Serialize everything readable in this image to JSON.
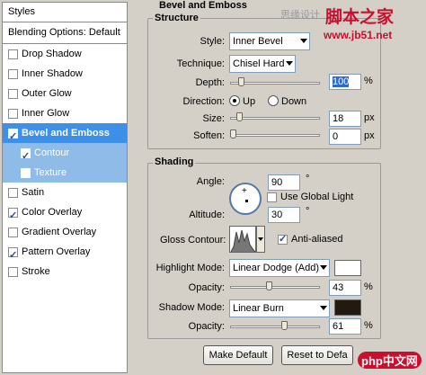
{
  "styles_panel": {
    "title": "Styles",
    "blending_options": "Blending Options: Default",
    "items": [
      {
        "label": "Drop Shadow",
        "checked": false
      },
      {
        "label": "Inner Shadow",
        "checked": false
      },
      {
        "label": "Outer Glow",
        "checked": false
      },
      {
        "label": "Inner Glow",
        "checked": false
      },
      {
        "label": "Bevel and Emboss",
        "checked": true
      },
      {
        "label": "Contour",
        "checked": true
      },
      {
        "label": "Texture",
        "checked": false
      },
      {
        "label": "Satin",
        "checked": false
      },
      {
        "label": "Color Overlay",
        "checked": true
      },
      {
        "label": "Gradient Overlay",
        "checked": false
      },
      {
        "label": "Pattern Overlay",
        "checked": true
      },
      {
        "label": "Stroke",
        "checked": false
      }
    ]
  },
  "bevel": {
    "title": "Bevel and Emboss",
    "structure": {
      "title": "Structure",
      "style_label": "Style:",
      "style_value": "Inner Bevel",
      "technique_label": "Technique:",
      "technique_value": "Chisel Hard",
      "depth_label": "Depth:",
      "depth_value": "100",
      "depth_unit": "%",
      "depth_level": 0.1,
      "direction_label": "Direction:",
      "up_label": "Up",
      "down_label": "Down",
      "size_label": "Size:",
      "size_value": "18",
      "size_unit": "px",
      "size_level": 0.07,
      "soften_label": "Soften:",
      "soften_value": "0",
      "soften_unit": "px",
      "soften_level": 0.0
    },
    "shading": {
      "title": "Shading",
      "angle_label": "Angle:",
      "angle_value": "90",
      "angle_unit": "°",
      "global_light_label": "Use Global Light",
      "altitude_label": "Altitude:",
      "altitude_value": "30",
      "altitude_unit": "°",
      "gloss_label": "Gloss Contour:",
      "anti_aliased_label": "Anti-aliased",
      "highlight_mode_label": "Highlight Mode:",
      "highlight_mode_value": "Linear Dodge (Add)",
      "highlight_color": "#ffffff",
      "highlight_opacity_label": "Opacity:",
      "highlight_opacity_value": "43",
      "highlight_opacity_unit": "%",
      "highlight_opacity_level": 0.43,
      "shadow_mode_label": "Shadow Mode:",
      "shadow_mode_value": "Linear Burn",
      "shadow_color": "#221a10",
      "shadow_opacity_label": "Opacity:",
      "shadow_opacity_value": "61",
      "shadow_opacity_unit": "%",
      "shadow_opacity_level": 0.61
    },
    "make_default_label": "Make Default",
    "reset_default_label": "Reset to Defa"
  },
  "watermark": {
    "top_text": "思缘设计",
    "brand": "脚本之家",
    "url": "www.jb51.net",
    "bottom_brand": "php中文网"
  }
}
